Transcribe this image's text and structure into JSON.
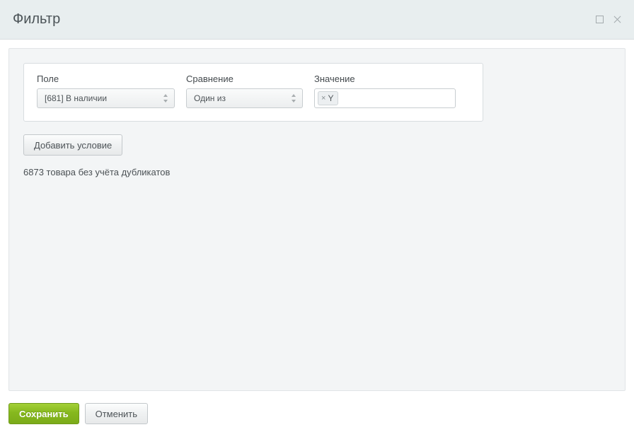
{
  "window": {
    "title": "Фильтр"
  },
  "labels": {
    "field": "Поле",
    "compare": "Сравнение",
    "value": "Значение"
  },
  "rule": {
    "field_selected": "[681] В наличии",
    "compare_selected": "Один из",
    "value_tags": [
      {
        "text": "Y"
      }
    ]
  },
  "buttons": {
    "add_condition": "Добавить условие",
    "save": "Сохранить",
    "cancel": "Отменить"
  },
  "status": {
    "text": "6873 товара без учёта дубликатов"
  }
}
